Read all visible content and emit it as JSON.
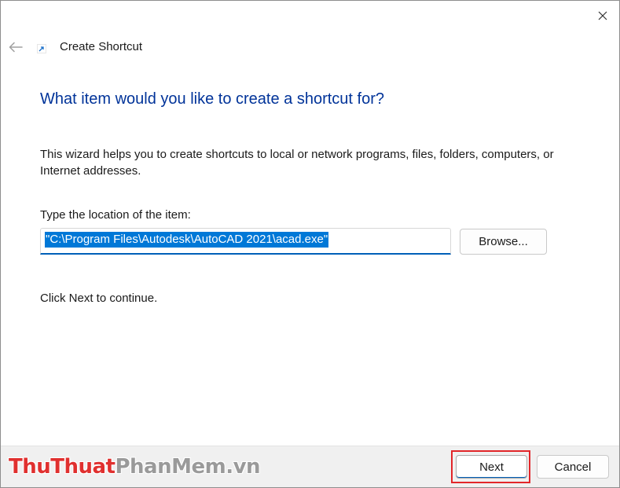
{
  "window": {
    "title": "Create Shortcut",
    "close_icon": "close-icon",
    "back_icon": "back-arrow-icon",
    "shortcut_icon": "shortcut-arrow-icon"
  },
  "page": {
    "heading": "What item would you like to create a shortcut for?",
    "description": "This wizard helps you to create shortcuts to local or network programs, files, folders, computers, or Internet addresses.",
    "location_label": "Type the location of the item:",
    "location_value": "\"C:\\Program Files\\Autodesk\\AutoCAD 2021\\acad.exe\"",
    "browse_label": "Browse...",
    "continue_text": "Click Next to continue."
  },
  "footer": {
    "next_label": "Next",
    "cancel_label": "Cancel"
  },
  "watermark": {
    "part1": "ThuThuat",
    "part2": "PhanMem",
    "part3": ".vn"
  },
  "colors": {
    "heading": "#003399",
    "accent": "#005fb8",
    "selection": "#0078d7",
    "highlight": "#e2262a"
  }
}
